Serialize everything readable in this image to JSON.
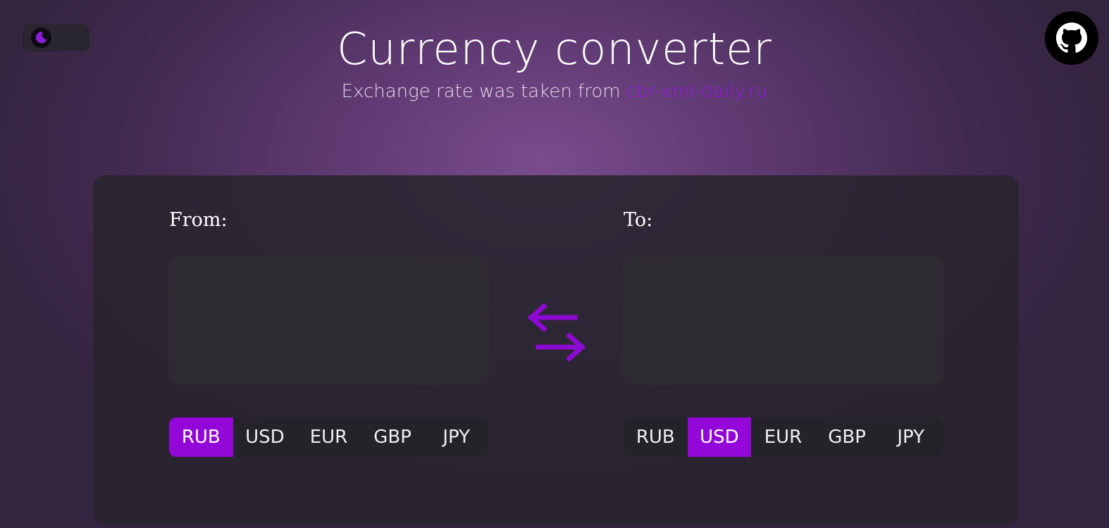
{
  "header": {
    "title": "Currency converter",
    "subtitle_prefix": "Exchange rate was taken from ",
    "source_link": "cbr-xml-daily.ru"
  },
  "icons": {
    "theme": "moon-icon",
    "github": "github-icon",
    "swap": "swap-arrows-icon"
  },
  "colors": {
    "accent": "#9308d9",
    "link": "#9a14ea",
    "card": "#28242e"
  },
  "converter": {
    "from": {
      "label": "From:",
      "value": "",
      "currencies": [
        "RUB",
        "USD",
        "EUR",
        "GBP",
        "JPY"
      ],
      "selected": "RUB"
    },
    "to": {
      "label": "To:",
      "value": "",
      "currencies": [
        "RUB",
        "USD",
        "EUR",
        "GBP",
        "JPY"
      ],
      "selected": "USD"
    }
  }
}
